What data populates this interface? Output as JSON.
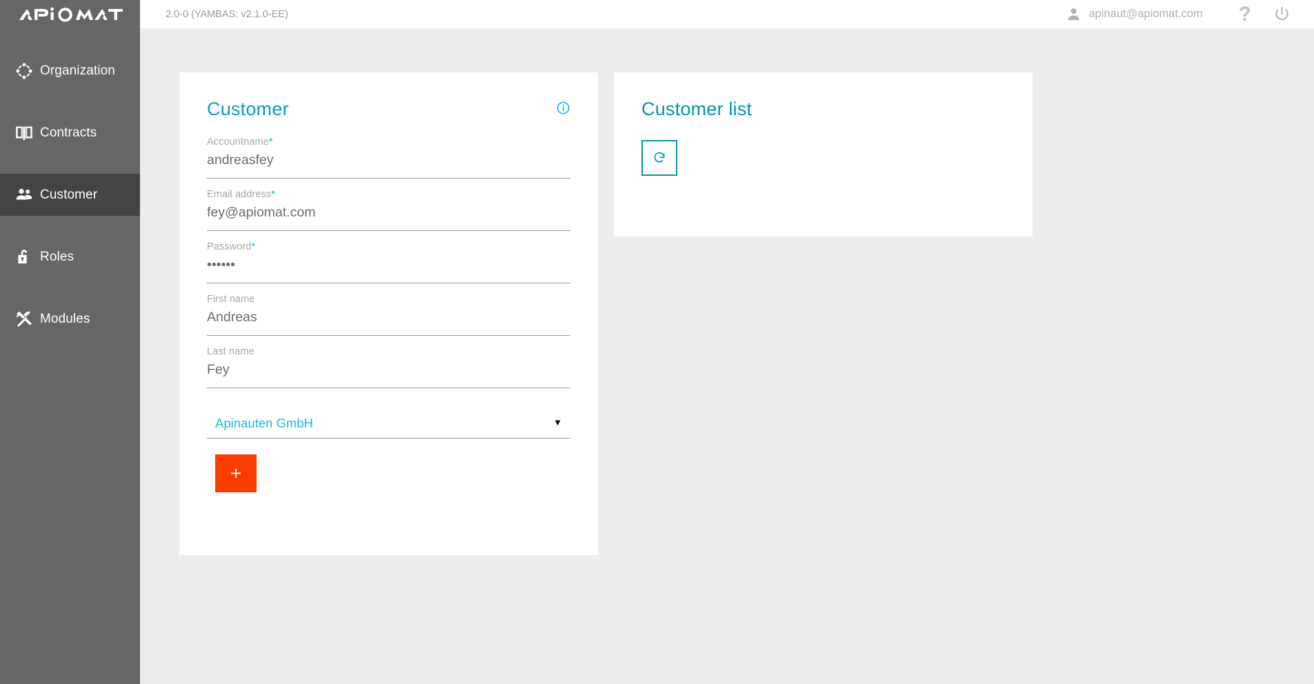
{
  "sidebar": {
    "logo_text": "APIOMAT",
    "items": [
      {
        "label": "Organization",
        "icon": "organization-network-icon",
        "active": false
      },
      {
        "label": "Contracts",
        "icon": "open-book-icon",
        "active": false
      },
      {
        "label": "Customer",
        "icon": "people-icon",
        "active": true
      },
      {
        "label": "Roles",
        "icon": "unlocked-padlock-icon",
        "active": false
      },
      {
        "label": "Modules",
        "icon": "hammer-wrench-icon",
        "active": false
      }
    ]
  },
  "topbar": {
    "version": "2.0-0 (YAMBAS: v2.1.0-EE)",
    "user_email": "apinaut@apiomat.com",
    "help_label": "?",
    "user_icon": "person-icon",
    "power_icon": "power-icon"
  },
  "customer_card": {
    "title": "Customer",
    "info_icon": "info-circle-icon",
    "fields": [
      {
        "label": "Accountname",
        "required": true,
        "value": "andreasfey",
        "type": "text",
        "placeholder": ""
      },
      {
        "label": "Email address",
        "required": true,
        "value": "fey@apiomat.com",
        "type": "text",
        "placeholder": ""
      },
      {
        "label": "Password",
        "required": true,
        "value": "••••••",
        "type": "password",
        "placeholder": ""
      },
      {
        "label": "First name",
        "required": false,
        "value": "Andreas",
        "type": "text",
        "placeholder": ""
      },
      {
        "label": "Last name",
        "required": false,
        "value": "Fey",
        "type": "text",
        "placeholder": ""
      }
    ],
    "organization_select": {
      "value": "Apinauten GmbH",
      "caret": "▼"
    },
    "add_button_label": "+"
  },
  "customer_list_card": {
    "title": "Customer list",
    "refresh_icon": "refresh-circular-arrow-icon"
  },
  "colors": {
    "sidebar_bg": "#666666",
    "sidebar_active_bg": "#444444",
    "page_bg": "#ededed",
    "accent_teal": "#0592a8",
    "accent_cyan": "#00b5dc",
    "accent_orange": "#fa3c00",
    "card_bg": "#ffffff"
  }
}
